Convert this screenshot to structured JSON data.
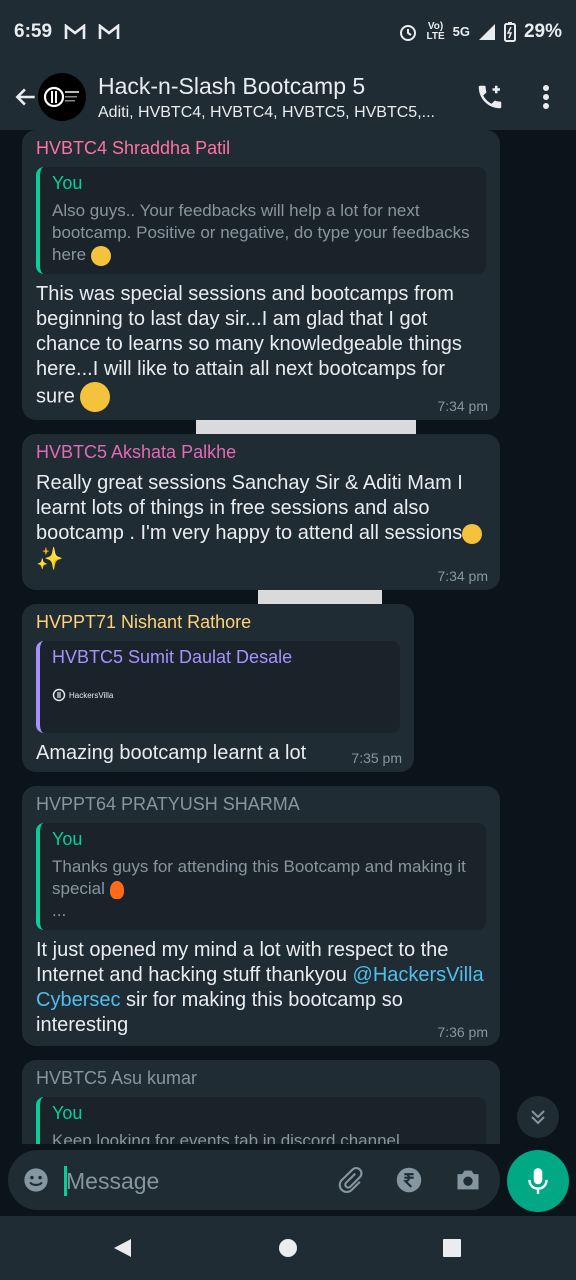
{
  "status_bar": {
    "time": "6:59",
    "network": "5G",
    "lte_top": "Vo)",
    "lte_bottom": "LTE",
    "battery": "29%"
  },
  "header": {
    "title": "Hack-n-Slash Bootcamp 5",
    "subtitle": "Aditi, HVBTC4, HVBTC4, HVBTC5, HVBTC5,..."
  },
  "colors": {
    "accent": "#00a884",
    "bubble": "#202c33",
    "background": "#0b141a",
    "sender_pink": "#ff72a1",
    "sender_violet": "#e26ab6",
    "sender_gold": "#ffd279",
    "sender_gray": "#8696a0",
    "quote_purple": "#a791ff"
  },
  "messages": [
    {
      "sender": "HVBTC4 Shraddha Patil",
      "quote_name": "You",
      "quote_text": "Also guys.. Your feedbacks will help a lot for next bootcamp. Positive or negative, do type your feedbacks here",
      "text": "This was special sessions and bootcamps from beginning to last day sir...I am glad that I got chance to learns so many knowledgeable things here...I will like to attain all next bootcamps for sure",
      "time": "7:34 pm"
    },
    {
      "sender": "HVBTC5 Akshata Palkhe",
      "text": "Really great sessions Sanchay Sir & Aditi Mam I learnt lots of things in free sessions and also bootcamp . I'm very happy to attend all sessions",
      "time": "7:34 pm"
    },
    {
      "sender": "HVPPT71 Nishant Rathore",
      "quote_name": "HVBTC5 Sumit Daulat Desale",
      "quote_image_label": "HackersVilla",
      "text": "Amazing bootcamp learnt a lot",
      "time": "7:35 pm"
    },
    {
      "sender": "HVPPT64 PRATYUSH SHARMA",
      "quote_name": "You",
      "quote_text_1": "Thanks guys for attending this Bootcamp and making it special",
      "quote_text_2": "...",
      "text_before": "It just opened my mind a lot with respect to the Internet and hacking stuff thankyou ",
      "mention": "@HackersVilla Cybersec",
      "text_after": " sir for making this bootcamp so interesting",
      "time": "7:36 pm"
    },
    {
      "sender": "HVBTC5 Asu kumar",
      "quote_name": "You",
      "quote_text": "Keep looking for events tab in discord channel"
    }
  ],
  "input": {
    "placeholder": "Message"
  },
  "icons": {
    "back": "arrow-left-icon",
    "call": "add-call-icon",
    "menu": "more-vert-icon",
    "emoji": "emoji-icon",
    "attach": "paperclip-icon",
    "payment": "rupee-icon",
    "camera": "camera-icon",
    "mic": "mic-icon",
    "scroll": "double-chevron-down-icon"
  }
}
